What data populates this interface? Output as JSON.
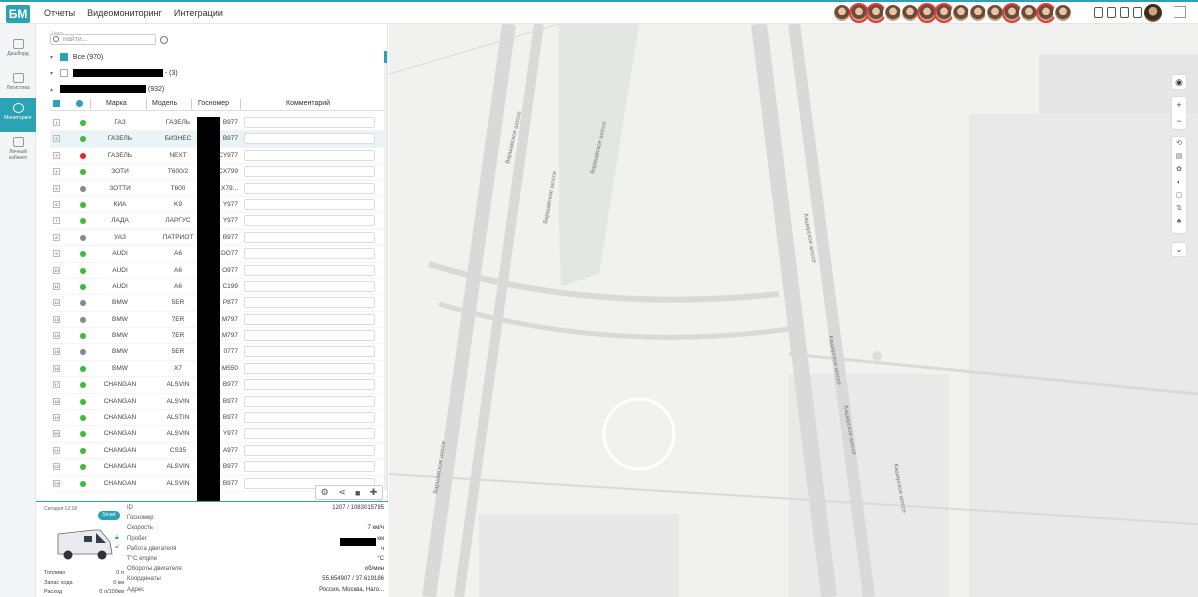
{
  "topnav": {
    "items": [
      "Отчеты",
      "Видеомониторинг",
      "Интеграции"
    ]
  },
  "brand": {
    "accent": "#2ba3b4",
    "logo_text": "БМ"
  },
  "sidebar": {
    "items": [
      {
        "label": "Дашборд",
        "icon": "dashboard-icon"
      },
      {
        "label": "Логистика",
        "icon": "logistics-icon"
      },
      {
        "label": "Мониторинг",
        "icon": "monitoring-icon"
      },
      {
        "label": "Личный кабинет",
        "icon": "account-icon"
      }
    ]
  },
  "search": {
    "label": "Поиск",
    "placeholder": "найти..."
  },
  "tree": {
    "all": "Все (970)",
    "group1_count": "- (3)",
    "group2_count": "(932)"
  },
  "table": {
    "headers": [
      "Марка",
      "Модель",
      "Госномер",
      "Комментарий"
    ],
    "rows": [
      {
        "n": "1",
        "status": "green",
        "brand": "ГАЗ",
        "model": "ГАЗЕЛЬ",
        "plate": "B977"
      },
      {
        "n": "2",
        "status": "green",
        "brand": "ГАЗЕЛЬ",
        "model": "БИЗНЕС",
        "plate": "B977"
      },
      {
        "n": "3",
        "status": "red",
        "brand": "ГАЗЕЛЬ",
        "model": "NEXT",
        "plate": "CY977"
      },
      {
        "n": "4",
        "status": "green",
        "brand": "ЗОТИ",
        "model": "T600/2",
        "plate": "CX799"
      },
      {
        "n": "5",
        "status": "gray",
        "brand": "ЗОТТИ",
        "model": "T600",
        "plate": "X79..."
      },
      {
        "n": "6",
        "status": "green",
        "brand": "КИА",
        "model": "K9",
        "plate": "Y977"
      },
      {
        "n": "7",
        "status": "green",
        "brand": "ЛАДА",
        "model": "ЛАРГУС",
        "plate": "Y977"
      },
      {
        "n": "8",
        "status": "gray",
        "brand": "УАЗ",
        "model": "ПАТРИОТ",
        "plate": "B977"
      },
      {
        "n": "9",
        "status": "green",
        "brand": "AUDI",
        "model": "A6",
        "plate": "DO77"
      },
      {
        "n": "10",
        "status": "green",
        "brand": "AUDI",
        "model": "A6",
        "plate": "O977"
      },
      {
        "n": "11",
        "status": "green",
        "brand": "AUDI",
        "model": "A6",
        "plate": "C199"
      },
      {
        "n": "12",
        "status": "gray",
        "brand": "BMW",
        "model": "5ER",
        "plate": "P877"
      },
      {
        "n": "13",
        "status": "gray",
        "brand": "BMW",
        "model": "7ER",
        "plate": "M797"
      },
      {
        "n": "14",
        "status": "green",
        "brand": "BMW",
        "model": "7ER",
        "plate": "M797"
      },
      {
        "n": "15",
        "status": "gray",
        "brand": "BMW",
        "model": "5ER",
        "plate": "0777"
      },
      {
        "n": "16",
        "status": "green",
        "brand": "BMW",
        "model": "X7",
        "plate": "M550"
      },
      {
        "n": "17",
        "status": "green",
        "brand": "CHANGAN",
        "model": "ALSVIN",
        "plate": "B977"
      },
      {
        "n": "18",
        "status": "green",
        "brand": "CHANGAN",
        "model": "ALSVIN",
        "plate": "B977"
      },
      {
        "n": "19",
        "status": "green",
        "brand": "CHANGAN",
        "model": "ALSTIN",
        "plate": "B977"
      },
      {
        "n": "20",
        "status": "green",
        "brand": "CHANGAN",
        "model": "ALSVIN",
        "plate": "Y977"
      },
      {
        "n": "21",
        "status": "green",
        "brand": "CHANGAN",
        "model": "CS35",
        "plate": "A977"
      },
      {
        "n": "22",
        "status": "green",
        "brand": "CHANGAN",
        "model": "ALSVIN",
        "plate": "B977"
      },
      {
        "n": "23",
        "status": "green",
        "brand": "CHANGAN",
        "model": "ALSVIN",
        "plate": "B977"
      }
    ]
  },
  "details": {
    "since": "Сегодня 12:18",
    "badge": "Smart",
    "fields": [
      {
        "k": "ID",
        "v": "1207 / 1083015795"
      },
      {
        "k": "Госномер",
        "v": ""
      },
      {
        "k": "Скорость",
        "v": "7 км/ч"
      },
      {
        "k": "Пробег",
        "v": "км"
      },
      {
        "k": "Работа двигателя",
        "v": "ч"
      },
      {
        "k": "T°C engine",
        "v": "°C"
      },
      {
        "k": "Обороты двигателя",
        "v": "об/мин"
      },
      {
        "k": "Координаты",
        "v": "55.654907 / 37.619186"
      },
      {
        "k": "Адрес",
        "v": "Россия, Москва, Наго..."
      }
    ],
    "fuel": [
      {
        "k": "Топливо",
        "v": "0 л"
      },
      {
        "k": "Запас хода",
        "v": "0 км"
      },
      {
        "k": "Расход",
        "v": "0 л/100км"
      }
    ]
  },
  "map": {
    "roads": [
      "Варшавское шоссе",
      "Варшавское шоссе",
      "Варшавское шоссе",
      "Варшавское шоссе",
      "Каширское шоссе",
      "Каширское шоссе",
      "Каширское шоссе",
      "Каширское шоссе"
    ]
  },
  "map_controls": {
    "zoom_in": "+",
    "zoom_out": "−"
  }
}
